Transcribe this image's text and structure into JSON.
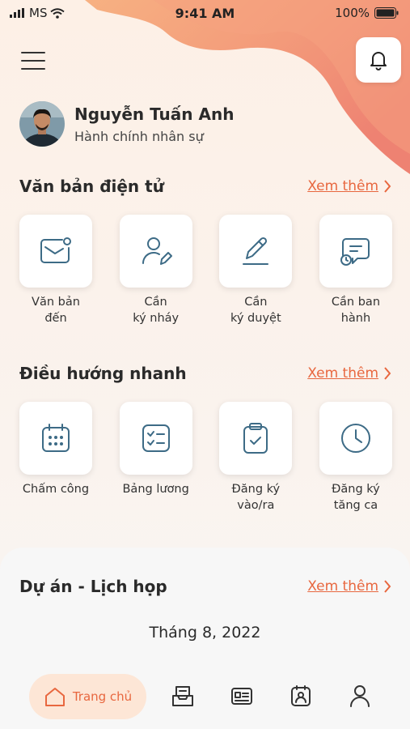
{
  "status_bar": {
    "carrier": "MS",
    "time": "9:41 AM",
    "battery": "100%"
  },
  "icons": {
    "menu": "hamburger-icon",
    "bell": "bell-icon",
    "chevron": "chevron-right-icon"
  },
  "user": {
    "name": "Nguyễn Tuấn Anh",
    "role": "Hành chính nhân sự"
  },
  "documents": {
    "title": "Văn bản điện tử",
    "see_more": "Xem thêm",
    "items": [
      {
        "line1": "Văn bản",
        "line2": "đến",
        "icon": "incoming-mail-icon"
      },
      {
        "line1": "Cần",
        "line2": "ký nháy",
        "icon": "user-edit-icon"
      },
      {
        "line1": "Cần",
        "line2": "ký duyệt",
        "icon": "pen-sign-icon"
      },
      {
        "line1": "Cần ban",
        "line2": "hành",
        "icon": "message-clock-icon"
      }
    ]
  },
  "quick_nav": {
    "title": "Điều hướng nhanh",
    "see_more": "Xem thêm",
    "items": [
      {
        "line1": "Chấm công",
        "line2": "",
        "icon": "calendar-icon"
      },
      {
        "line1": "Bảng lương",
        "line2": "",
        "icon": "checklist-icon"
      },
      {
        "line1": "Đăng ký",
        "line2": "vào/ra",
        "icon": "clipboard-check-icon"
      },
      {
        "line1": "Đăng ký",
        "line2": "tăng ca",
        "icon": "clock-icon"
      }
    ]
  },
  "projects": {
    "title": "Dự án - Lịch họp",
    "see_more": "Xem thêm",
    "month": "Tháng 8, 2022"
  },
  "tab_bar": {
    "home_label": "Trang chủ",
    "tabs": [
      "home-icon",
      "inbox-icon",
      "news-icon",
      "badge-icon",
      "profile-icon"
    ]
  },
  "colors": {
    "accent": "#e8673f",
    "icon_blue": "#3d6b86",
    "home_pill": "#fde6d6"
  }
}
